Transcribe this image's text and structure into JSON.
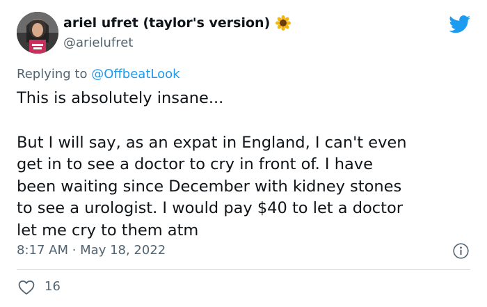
{
  "user": {
    "display_name": "ariel ufret (taylor's version)",
    "handle": "@arielufret"
  },
  "reply": {
    "prefix": "Replying to",
    "mention": "@OffbeatLook"
  },
  "tweet": {
    "lines": [
      "This is absolutely insane...",
      "But I will say, as an expat in England, I can't even",
      "get in to see a doctor to cry in front of.  I have",
      "been waiting since December with kidney stones",
      "to see a urologist.  I would pay $40 to let a doctor",
      "let me cry to them atm"
    ]
  },
  "meta": {
    "timestamp": "8:17 AM · May 18, 2022"
  },
  "engagement": {
    "likes": "16"
  },
  "icons": {
    "brand": "twitter-bird-icon",
    "name_emoji": "sunflower-icon",
    "info": "info-icon",
    "like": "heart-icon"
  },
  "colors": {
    "brand_blue": "#1d9bf0",
    "text": "#0f1419",
    "muted": "#536471"
  }
}
